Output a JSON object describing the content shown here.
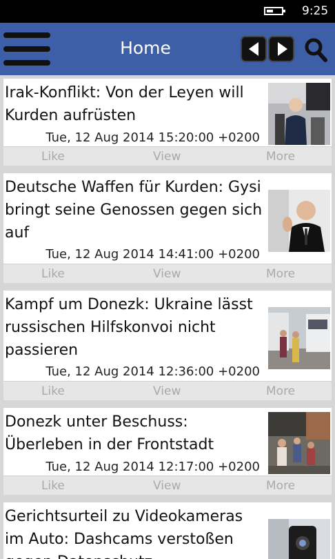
{
  "statusbar": {
    "time": "9:25"
  },
  "appbar": {
    "title": "Home"
  },
  "actions": {
    "like": "Like",
    "view": "View",
    "more": "More"
  },
  "articles": [
    {
      "title": "Irak-Konflikt: Von der Leyen will Kurden aufrüsten",
      "date": "Tue, 12 Aug 2014 15:20:00 +0200"
    },
    {
      "title": "Deutsche Waffen für Kurden: Gysi bringt seine Genossen gegen sich auf",
      "date": "Tue, 12 Aug 2014 14:41:00 +0200"
    },
    {
      "title": "Kampf um Donezk: Ukraine lässt russischen Hilfskonvoi nicht passieren",
      "date": "Tue, 12 Aug 2014 12:36:00 +0200"
    },
    {
      "title": "Donezk unter Beschuss: Überleben in der Frontstadt",
      "date": "Tue, 12 Aug 2014 12:17:00 +0200"
    },
    {
      "title": "Gerichtsurteil zu Videokameras im Auto: Dashcams verstoßen gegen Datenschutz",
      "date": ""
    }
  ],
  "colors": {
    "appbar": "#3d5fa8",
    "statusbar": "#000000",
    "background": "#d6d6d6"
  }
}
